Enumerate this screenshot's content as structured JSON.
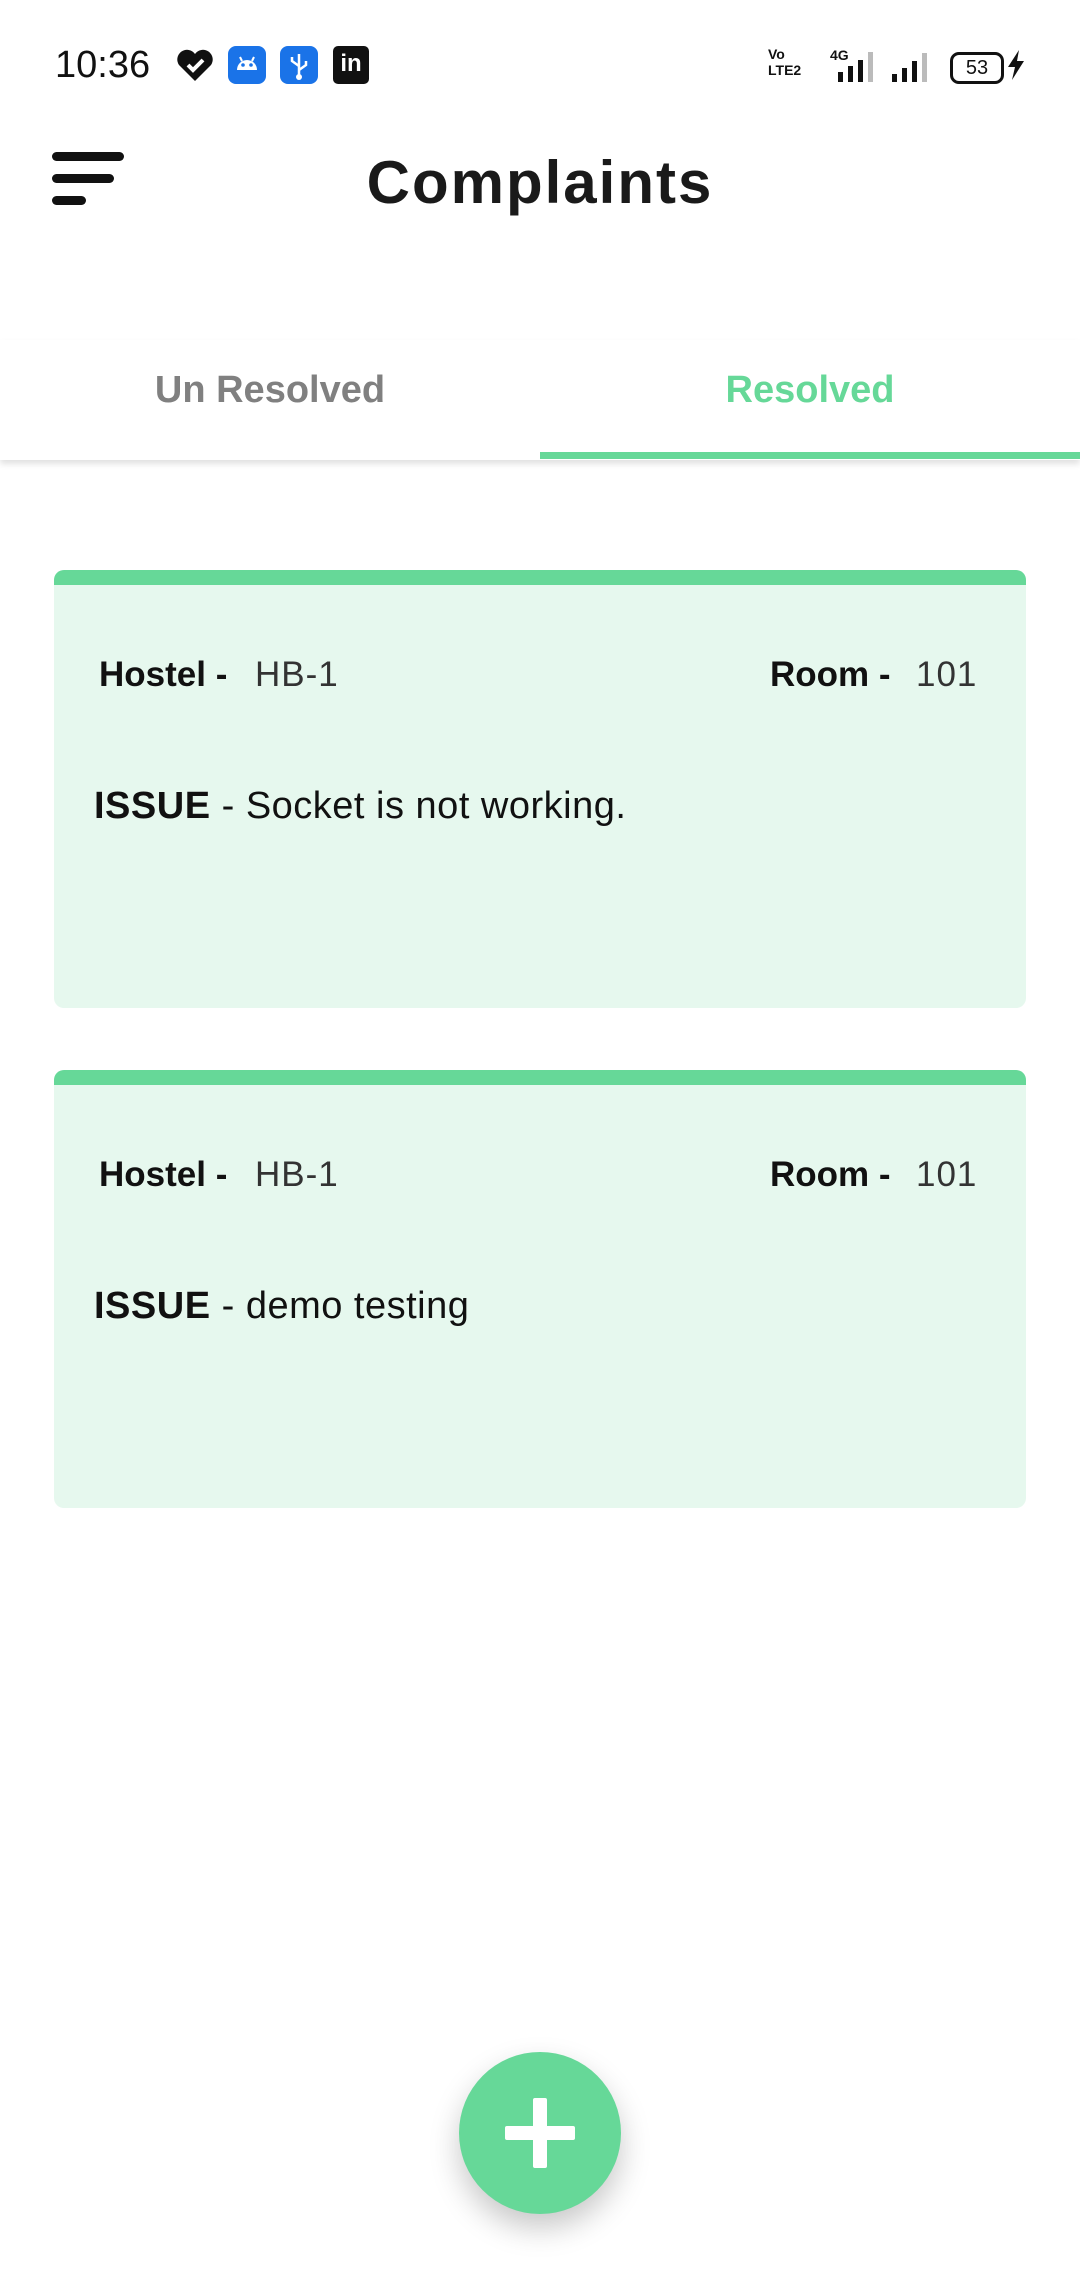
{
  "status_bar": {
    "time": "10:36",
    "icons": [
      "heart-check-icon",
      "android-icon",
      "usb-icon",
      "linkedin-icon",
      "volte-icon",
      "signal-4g-icon",
      "signal-icon",
      "battery-icon",
      "charging-bolt-icon"
    ],
    "volte_text": "Vo LTE2",
    "network": "4G",
    "battery": "53",
    "linkedin_text": "in"
  },
  "app_bar": {
    "title": "Complaints",
    "menu_icon": "menu-icon"
  },
  "tabs": [
    {
      "label": "Un Resolved",
      "selected": false
    },
    {
      "label": "Resolved",
      "selected": true
    }
  ],
  "complaints": [
    {
      "hostel_label": "Hostel -",
      "hostel": "HB-1",
      "room_label": "Room -",
      "room": "101",
      "issue_label": "ISSUE",
      "issue_text": " - Socket is not working."
    },
    {
      "hostel_label": "Hostel -",
      "hostel": "HB-1",
      "room_label": "Room -",
      "room": "101",
      "issue_label": "ISSUE",
      "issue_text": " - demo testing"
    }
  ],
  "fab": {
    "icon": "plus-icon"
  },
  "colors": {
    "accent": "#66d898",
    "card_background": "#e6f8ee",
    "unselected_tab": "#808080"
  }
}
